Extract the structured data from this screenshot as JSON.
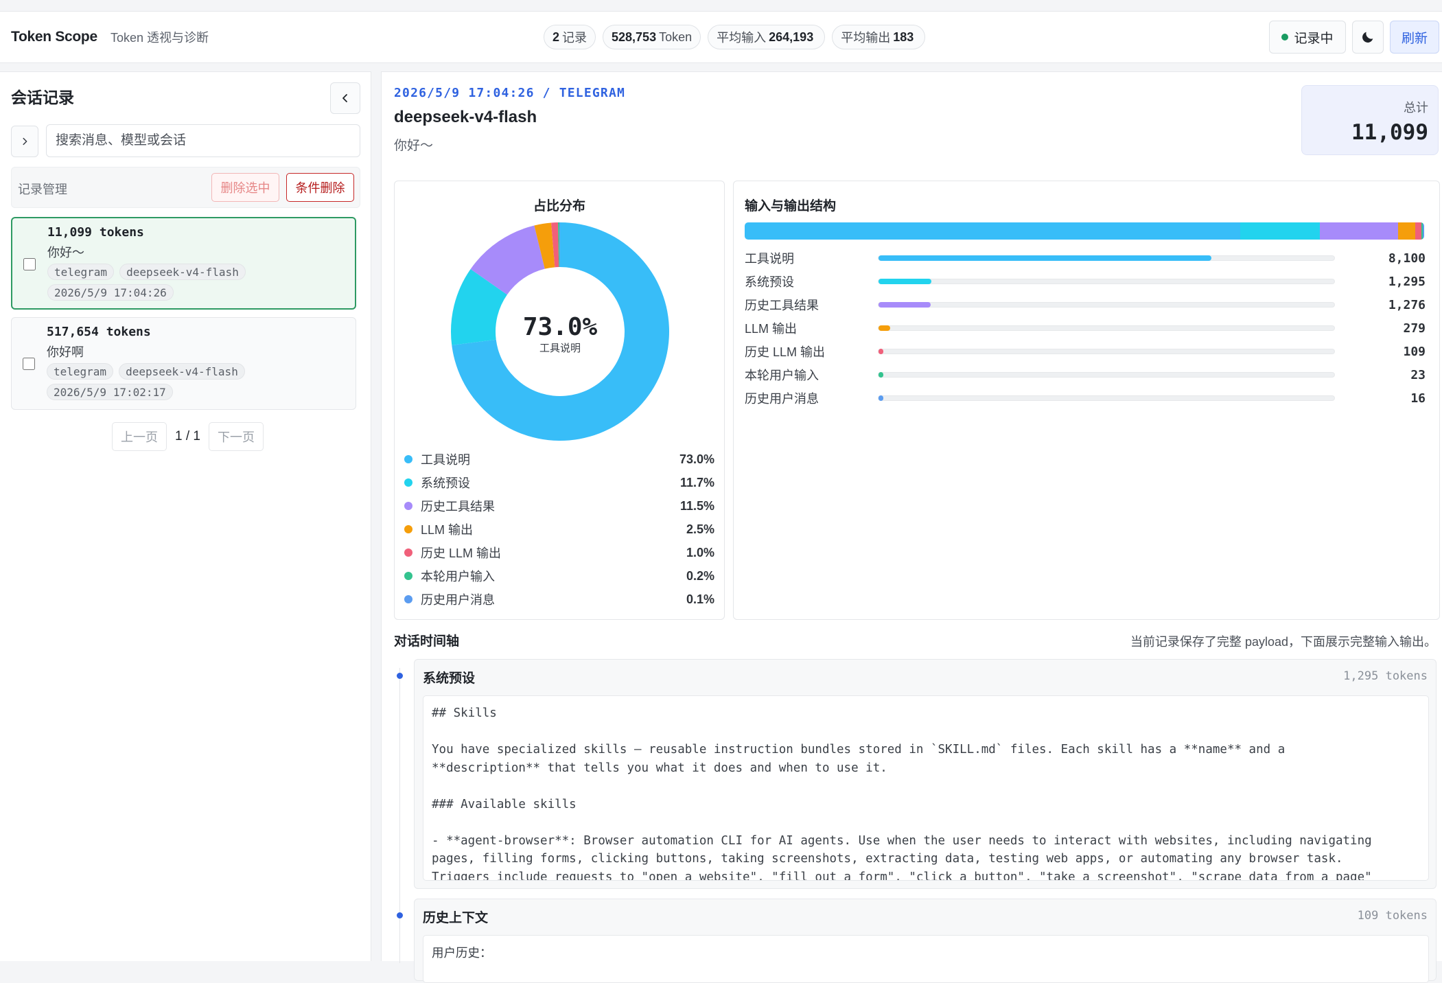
{
  "app": {
    "name": "Token Scope",
    "subtitle": "Token 透视与诊断"
  },
  "stats": {
    "records_value": "2",
    "records_label": "记录",
    "tokens_value": "528,753",
    "tokens_label": "Token",
    "avg_in_label": "平均输入",
    "avg_in_value": "264,193",
    "avg_out_label": "平均输出",
    "avg_out_value": "183"
  },
  "actions": {
    "recording_label": "记录中",
    "refresh_label": "刷新",
    "theme_icon": "moon-icon"
  },
  "sidebar": {
    "title": "会话记录",
    "search_placeholder": "搜索消息、模型或会话",
    "manage_label": "记录管理",
    "delete_selected": "删除选中",
    "delete_by_condition": "条件删除",
    "records": [
      {
        "tokens": "11,099 tokens",
        "message": "你好～",
        "channel": "telegram",
        "model": "deepseek-v4-flash",
        "time": "2026/5/9 17:04:26",
        "active": true
      },
      {
        "tokens": "517,654 tokens",
        "message": "你好啊",
        "channel": "telegram",
        "model": "deepseek-v4-flash",
        "time": "2026/5/9 17:02:17",
        "active": false
      }
    ],
    "pager": {
      "prev": "上一页",
      "page": "1 / 1",
      "next": "下一页"
    }
  },
  "detail": {
    "meta": "2026/5/9 17:04:26 / TELEGRAM",
    "model": "deepseek-v4-flash",
    "message": "你好～",
    "total_label": "总计",
    "total_value": "11,099"
  },
  "chart_data": [
    {
      "type": "pie",
      "title": "占比分布",
      "center_value": "73.0%",
      "center_label": "工具说明",
      "categories": [
        "工具说明",
        "系统预设",
        "历史工具结果",
        "LLM 输出",
        "历史 LLM 输出",
        "本轮用户输入",
        "历史用户消息"
      ],
      "values": [
        73.0,
        11.7,
        11.5,
        2.5,
        1.0,
        0.2,
        0.1
      ],
      "labels": [
        "73.0%",
        "11.7%",
        "11.5%",
        "2.5%",
        "1.0%",
        "0.2%",
        "0.1%"
      ],
      "colors": [
        "#38bdf8",
        "#22d3ee",
        "#a78bfa",
        "#f59e0b",
        "#f0607a",
        "#34c38f",
        "#5b9cf0"
      ]
    },
    {
      "type": "bar",
      "title": "输入与输出结构",
      "categories": [
        "工具说明",
        "系统预设",
        "历史工具结果",
        "LLM 输出",
        "历史 LLM 输出",
        "本轮用户输入",
        "历史用户消息"
      ],
      "values": [
        8100,
        1295,
        1276,
        279,
        109,
        23,
        16
      ],
      "labels": [
        "8,100",
        "1,295",
        "1,276",
        "279",
        "109",
        "23",
        "16"
      ],
      "total": 11099,
      "colors": [
        "#38bdf8",
        "#22d3ee",
        "#a78bfa",
        "#f59e0b",
        "#f0607a",
        "#34c38f",
        "#5b9cf0"
      ]
    }
  ],
  "timeline": {
    "title": "对话时间轴",
    "note": "当前记录保存了完整 payload，下面展示完整输入输出。",
    "items": [
      {
        "title": "系统预设",
        "tokens": "1,295 tokens",
        "content": "## Skills\n\nYou have specialized skills — reusable instruction bundles stored in `SKILL.md` files. Each skill has a **name** and a\n**description** that tells you what it does and when to use it.\n\n### Available skills\n\n- **agent-browser**: Browser automation CLI for AI agents. Use when the user needs to interact with websites, including navigating\npages, filling forms, clicking buttons, taking screenshots, extracting data, testing web apps, or automating any browser task.\nTriggers include requests to \"open a website\", \"fill out a form\", \"click a button\", \"take a screenshot\", \"scrape data from a page\""
      },
      {
        "title": "历史上下文",
        "tokens": "109 tokens",
        "content": "用户历史："
      }
    ]
  }
}
